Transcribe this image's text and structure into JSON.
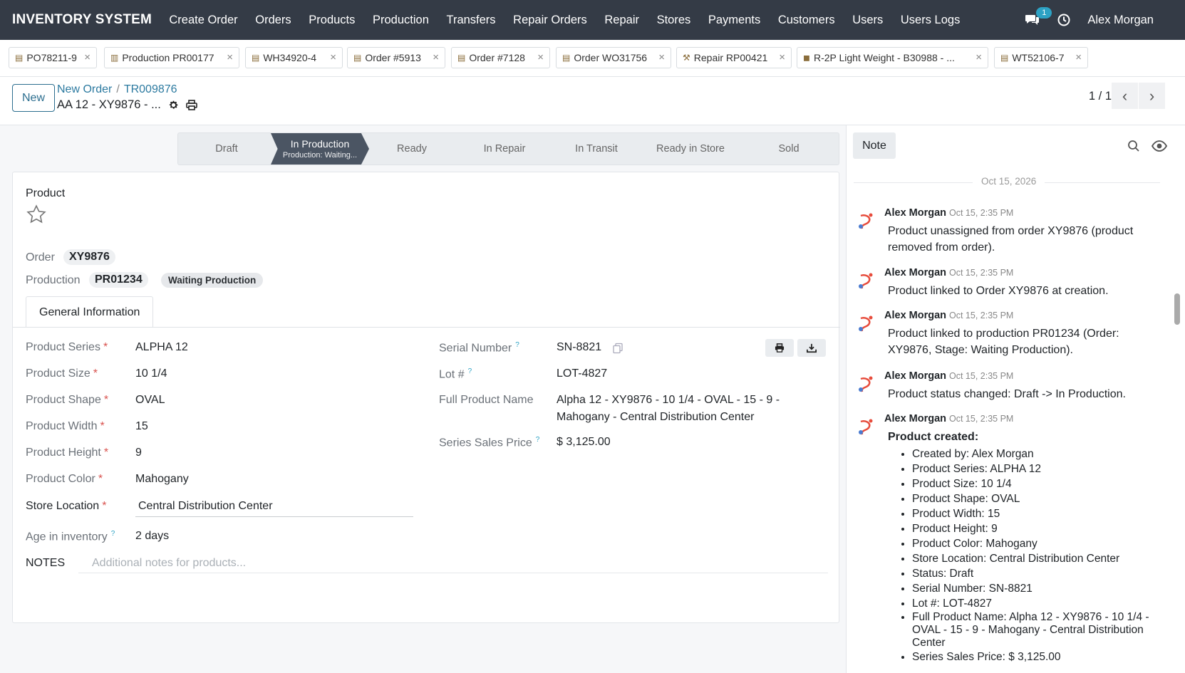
{
  "topnav": {
    "brand": "INVENTORY SYSTEM",
    "menu": [
      "Create Order",
      "Orders",
      "Products",
      "Production",
      "Transfers",
      "Repair Orders",
      "Repair",
      "Stores",
      "Payments",
      "Customers",
      "Users",
      "Users Logs"
    ],
    "chat_count": "1",
    "user": "Alex Morgan"
  },
  "tabs": [
    {
      "label": "PO78211-9",
      "icon": "clipboard-icon"
    },
    {
      "label": "Production PR00177",
      "icon": "factory-icon"
    },
    {
      "label": "WH34920-4",
      "icon": "clipboard-icon"
    },
    {
      "label": "Order #5913",
      "icon": "clipboard-icon"
    },
    {
      "label": "Order #7128",
      "icon": "clipboard-icon"
    },
    {
      "label": "Order WO31756",
      "icon": "clipboard-icon"
    },
    {
      "label": "Repair RP00421",
      "icon": "wrench-icon"
    },
    {
      "label": "R-2P Light Weight - B30988 - ...",
      "icon": "package-icon"
    },
    {
      "label": "WT52106-7",
      "icon": "clipboard-icon"
    }
  ],
  "control": {
    "new_label": "New",
    "breadcrumb_parent": "New Order",
    "breadcrumb_current": "TR009876",
    "record_title": "AA 12 - XY9876 - ...",
    "pager": "1 / 1"
  },
  "statusbar": {
    "stages": [
      "Draft",
      "In Production",
      "Ready",
      "In Repair",
      "In Transit",
      "Ready in Store",
      "Sold"
    ],
    "active": "In Production",
    "active_sub": "Production: Waiting..."
  },
  "form": {
    "section_title": "Product",
    "order_label": "Order",
    "order_value": "XY9876",
    "production_label": "Production",
    "production_value": "PR01234",
    "production_status": "Waiting Production",
    "tab_general": "General Information",
    "left_fields": [
      {
        "label": "Product Series",
        "value": "ALPHA 12",
        "required": true
      },
      {
        "label": "Product Size",
        "value": "10 1/4",
        "required": true
      },
      {
        "label": "Product Shape",
        "value": "OVAL",
        "required": true
      },
      {
        "label": "Product Width",
        "value": "15",
        "required": true
      },
      {
        "label": "Product Height",
        "value": "9",
        "required": true
      },
      {
        "label": "Product Color",
        "value": "Mahogany",
        "required": true
      },
      {
        "label": "Store Location",
        "value": "Central Distribution Center",
        "required": true
      },
      {
        "label": "Age in inventory",
        "value": "2 days",
        "required": false
      }
    ],
    "serial_label": "Serial Number",
    "serial_value": "SN-8821",
    "lot_label": "Lot #",
    "lot_value": "LOT-4827",
    "full_name_label": "Full Product Name",
    "full_name_line1": "Alpha 12 - XY9876 - 10 1/4 - OVAL - 15 - 9 -",
    "full_name_line2": "Mahogany - Central Distribution Center",
    "price_label": "Series Sales Price",
    "price_value": "$ 3,125.00",
    "notes_label": "NOTES",
    "notes_placeholder": "Additional notes for products...",
    "required_mark": "*",
    "help_mark": "?"
  },
  "chatter": {
    "note_label": "Note",
    "date": "Oct 15, 2026",
    "messages": [
      {
        "author": "Alex Morgan",
        "time": "Oct 15, 2:35 PM",
        "text": "Product unassigned from order XY9876 (product removed from order)."
      },
      {
        "author": "Alex Morgan",
        "time": "Oct 15, 2:35 PM",
        "text": "Product linked to Order XY9876 at creation."
      },
      {
        "author": "Alex Morgan",
        "time": "Oct 15, 2:35 PM",
        "text": "Product linked to production PR01234 (Order: XY9876, Stage: Waiting Production)."
      },
      {
        "author": "Alex Morgan",
        "time": "Oct 15, 2:35 PM",
        "text": "Product status changed: Draft -> In Production."
      },
      {
        "author": "Alex Morgan",
        "time": "Oct 15, 2:35 PM",
        "title": "Product created:",
        "items": [
          "Created by: Alex Morgan",
          "Product Series: ALPHA 12",
          "Product Size: 10 1/4",
          "Product Shape: OVAL",
          "Product Width: 15",
          "Product Height: 9",
          "Product Color: Mahogany",
          "Store Location: Central Distribution Center",
          "Status: Draft",
          "Serial Number: SN-8821",
          "Lot #: LOT-4827",
          "Full Product Name: Alpha 12 - XY9876 - 10 1/4 - OVAL - 15 - 9 - Mahogany - Central Distribution Center",
          "Series Sales Price: $ 3,125.00"
        ]
      }
    ]
  },
  "colors": {
    "nav_bg": "#343b46",
    "accent": "#2c7aa0",
    "required": "#d9534f",
    "active_stage": "#4b5563"
  }
}
